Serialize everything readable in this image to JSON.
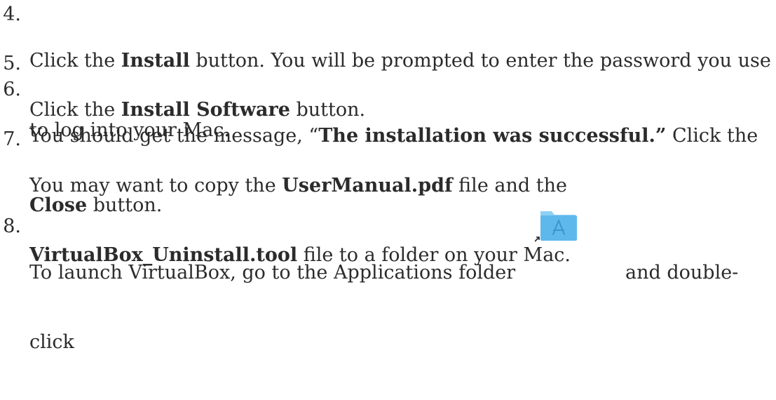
{
  "steps": [
    {
      "num": "4.",
      "lines": [
        [
          {
            "t": "Click the "
          },
          {
            "t": "Install",
            "b": true
          },
          {
            "t": " button. You will be prompted to enter the password you use"
          }
        ],
        [
          {
            "t": "to log into your Mac."
          }
        ]
      ]
    },
    {
      "num": "5.",
      "lines": [
        [
          {
            "t": "Click the "
          },
          {
            "t": "Install Software",
            "b": true
          },
          {
            "t": " button."
          }
        ]
      ]
    },
    {
      "num": "6.",
      "lines": [
        [
          {
            "t": "You should get the message, “"
          },
          {
            "t": "The installation was successful.”",
            "b": true
          },
          {
            "t": " Click the"
          }
        ],
        [
          {
            "t": "Close",
            "b": true
          },
          {
            "t": " button."
          }
        ]
      ]
    },
    {
      "num": "7.",
      "lines": [
        [
          {
            "t": "You may want to copy the "
          },
          {
            "t": "UserManual.pdf",
            "b": true
          },
          {
            "t": " file and the"
          }
        ],
        [
          {
            "t": "VirtualBox_Uninstall.tool",
            "b": true
          },
          {
            "t": " file to a folder on your Mac."
          }
        ]
      ]
    },
    {
      "num": "8.",
      "lines": [
        [
          {
            "t": "To launch VirtualBox, go to the Applications folder"
          },
          {
            "t": "and double-",
            "gap": true
          }
        ],
        [
          {
            "t": "click"
          }
        ]
      ]
    }
  ],
  "icon": {
    "name": "applications-folder-icon",
    "folder_color": "#5fb8ec",
    "tab_color": "#8fd0f5",
    "glyph_color": "#3e93cf"
  }
}
